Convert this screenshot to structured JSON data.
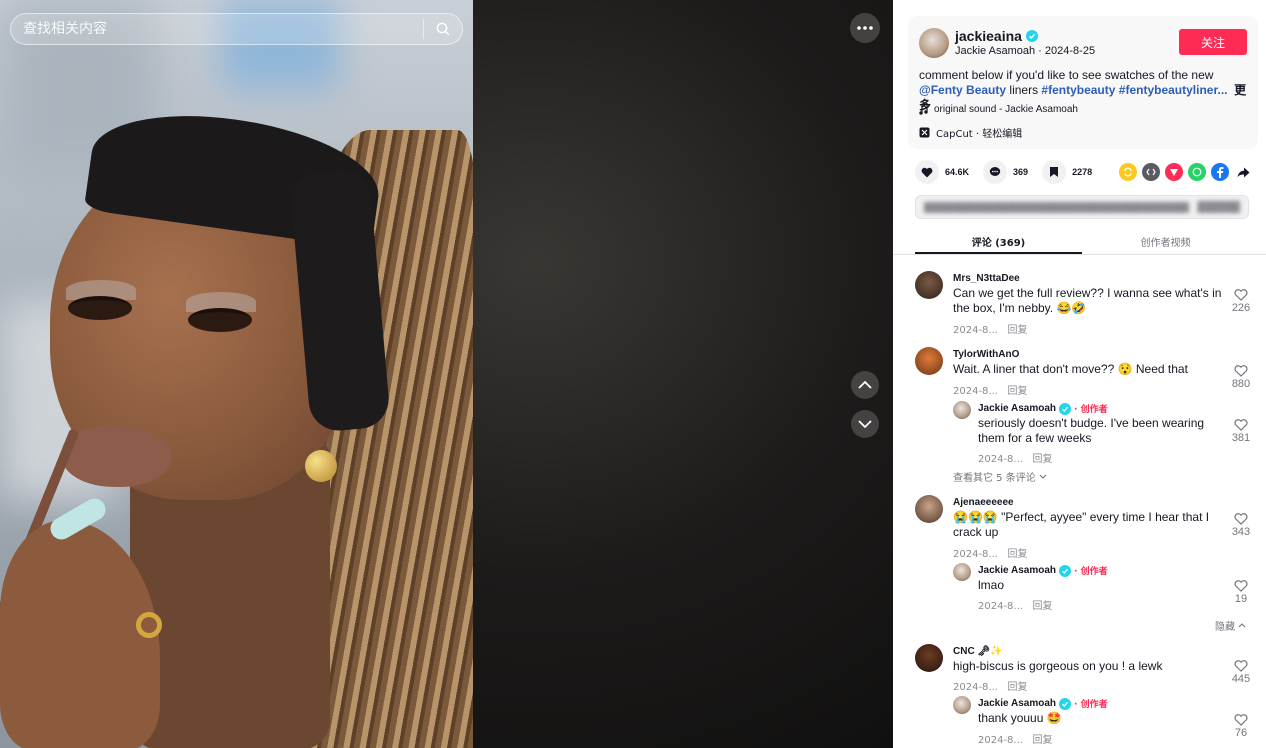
{
  "search": {
    "placeholder": "查找相关内容"
  },
  "author": {
    "username": "jackieaina",
    "display_name": "Jackie Asamoah",
    "date": "2024-8-25",
    "follow_label": "关注"
  },
  "description": {
    "text": "comment below if you'd like to see swatches of the new ",
    "mention": "@Fenty Beauty",
    "mid": " liners ",
    "tag1": "#fentybeauty",
    "tag2": "#fentybeautyliner...",
    "more_label": "更多"
  },
  "sound": {
    "label": "original sound - Jackie Asamoah"
  },
  "capcut": {
    "label": "CapCut · 轻松编辑"
  },
  "stats": {
    "likes": "64.6K",
    "comments": "369",
    "saves": "2278"
  },
  "tabs": [
    {
      "label": "评论 (369)"
    },
    {
      "label": "创作者视频"
    }
  ],
  "comments": [
    {
      "name": "Mrs_N3ttaDee",
      "text": "Can we get the full review?? I wanna see what's in the box, I'm nebby. 😂🤣",
      "date": "2024-8...",
      "reply_label": "回复",
      "likes": "226"
    },
    {
      "name": "TylorWithAnO",
      "text": "Wait. A liner that don't move?? 😯 Need that",
      "date": "2024-8...",
      "reply_label": "回复",
      "likes": "880",
      "reply": {
        "name": "Jackie Asamoah",
        "creator": "· 创作者",
        "text": "seriously doesn't budge. I've been wearing them for a few weeks",
        "date": "2024-8...",
        "reply_label": "回复",
        "likes": "381"
      },
      "view_more": "查看其它 5 条评论"
    },
    {
      "name": "Ajenaeeeeee",
      "text": "😭😭😭 \"Perfect, ayyee\" every time I hear that I crack up",
      "date": "2024-8...",
      "reply_label": "回复",
      "likes": "343",
      "reply": {
        "name": "Jackie Asamoah",
        "creator": "· 创作者",
        "text": "lmao",
        "date": "2024-8...",
        "reply_label": "回复",
        "likes": "19"
      },
      "hide_label": "隐藏"
    },
    {
      "name": "CNC 🗝✨",
      "text": "high-biscus is gorgeous on you ! a lewk",
      "date": "2024-8...",
      "reply_label": "回复",
      "likes": "445",
      "reply": {
        "name": "Jackie Asamoah",
        "creator": "· 创作者",
        "text": "thank youuu 🤩",
        "date": "2024-8...",
        "reply_label": "回复",
        "likes": "76"
      }
    }
  ],
  "colors": {
    "accent": "#fe2c55",
    "link": "#2b5db9",
    "verified": "#20d5ec"
  }
}
